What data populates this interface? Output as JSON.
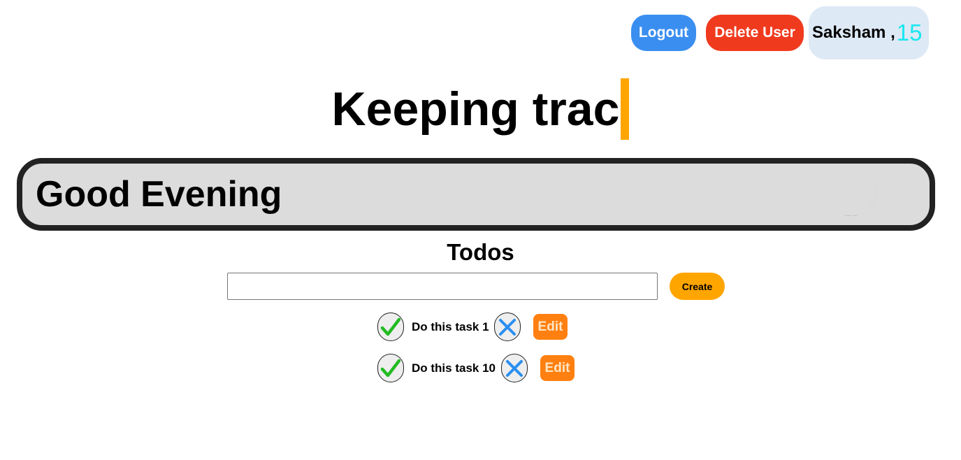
{
  "header": {
    "logout_label": "Logout",
    "delete_user_label": "Delete User",
    "user_name": "Saksham ,",
    "user_age": "15"
  },
  "hero": {
    "typewriter_text": "Keeping trac"
  },
  "greeting": {
    "text": "Good Evening",
    "icon": "moon-icon"
  },
  "todos": {
    "title": "Todos",
    "input_value": "",
    "create_label": "Create",
    "items": [
      {
        "text": "Do this task 1",
        "edit_label": "Edit"
      },
      {
        "text": "Do this task 10",
        "edit_label": "Edit"
      }
    ]
  },
  "colors": {
    "logout": "#3a8ef0",
    "delete": "#f03a1e",
    "accent": "#ffa500",
    "edit": "#ff8010",
    "age": "#18e8f0"
  }
}
